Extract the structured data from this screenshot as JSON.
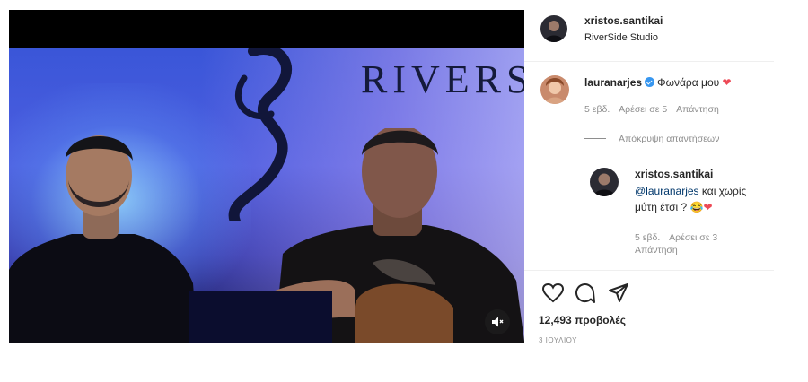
{
  "post": {
    "author": "xristos.santikai",
    "location": "RiverSide Studio",
    "video": {
      "brand_text": "RIVERS",
      "mute_icon": "speaker-muted-icon"
    }
  },
  "comments": [
    {
      "username": "lauranarjes",
      "verified": true,
      "text": "Φωνάρα μου",
      "emoji": "❤",
      "age": "5 εβδ.",
      "likes": "Αρέσει σε 5",
      "reply_label": "Απάντηση",
      "hide_replies_label": "Απόκρυψη απαντήσεων",
      "replies": [
        {
          "username": "xristos.santikai",
          "mention": "@lauranarjes",
          "text_line1": " και χωρίς",
          "text_line2": "μύτη έτσι ?",
          "emoji": "😂",
          "emoji2": "❤",
          "age": "5 εβδ.",
          "likes": "Αρέσει σε 3",
          "reply_label": "Απάντηση"
        }
      ]
    }
  ],
  "actions": {
    "icons": [
      "heart-icon",
      "comment-icon",
      "share-icon"
    ],
    "views": "12,493 προβολές",
    "date": "3 ΙΟΥΛΙΟΥ"
  },
  "colors": {
    "accent_blue": "#3897f0",
    "heart_red": "#ed4956",
    "meta_gray": "#8e8e8e",
    "link_blue": "#00376b"
  }
}
